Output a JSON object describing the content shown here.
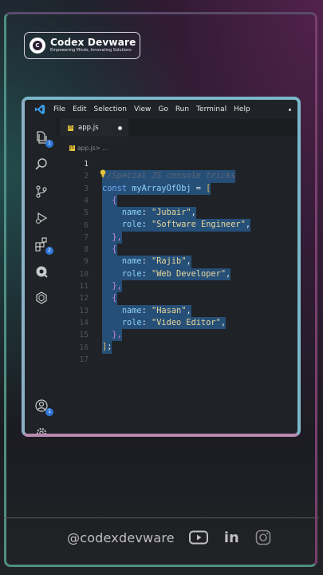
{
  "brand": {
    "title": "Codex Devware",
    "tagline": "Empowering Minds, Innovating Solutions",
    "mark": "C"
  },
  "menubar": {
    "items": [
      "File",
      "Edit",
      "Selection",
      "View",
      "Go",
      "Run",
      "Terminal",
      "Help"
    ]
  },
  "activity": {
    "explorer_badge": "1",
    "extensions_badge": "2",
    "account_badge": "1"
  },
  "tab": {
    "filename": "app.js",
    "icon_label": "JS"
  },
  "breadcrumb": {
    "file": "app.js",
    "rest": " > ..."
  },
  "code": {
    "line_numbers": [
      "1",
      "2",
      "3",
      "4",
      "5",
      "6",
      "7",
      "8",
      "9",
      "10",
      "11",
      "12",
      "13",
      "14",
      "15",
      "16",
      "17"
    ],
    "line1": "//Special JS console tricks",
    "line2_kw": "const",
    "line2_var": "myArrayOfObj",
    "line2_op": " = ",
    "line2_br": "[",
    "open_brace": "{",
    "close_brace": "},",
    "key_name": "name",
    "key_role": "role",
    "colon": ": ",
    "comma": ",",
    "item1_name": "\"Jubair\"",
    "item1_role": "\"Software Engineer\"",
    "item2_name": "\"Rajib\"",
    "item2_role": "\"Web Developer\"",
    "item3_name": "\"Hasan\"",
    "item3_role": "\"Video Editor\"",
    "line15": "];",
    "line15_br": "]",
    "line15_semi": ";"
  },
  "footer": {
    "handle": "@codexdevware",
    "linkedin": "in"
  },
  "colors": {
    "editor_bg": "#1f2226",
    "selection": "#264f78",
    "string": "#e8d69a",
    "keyword": "#6ea8f5"
  }
}
